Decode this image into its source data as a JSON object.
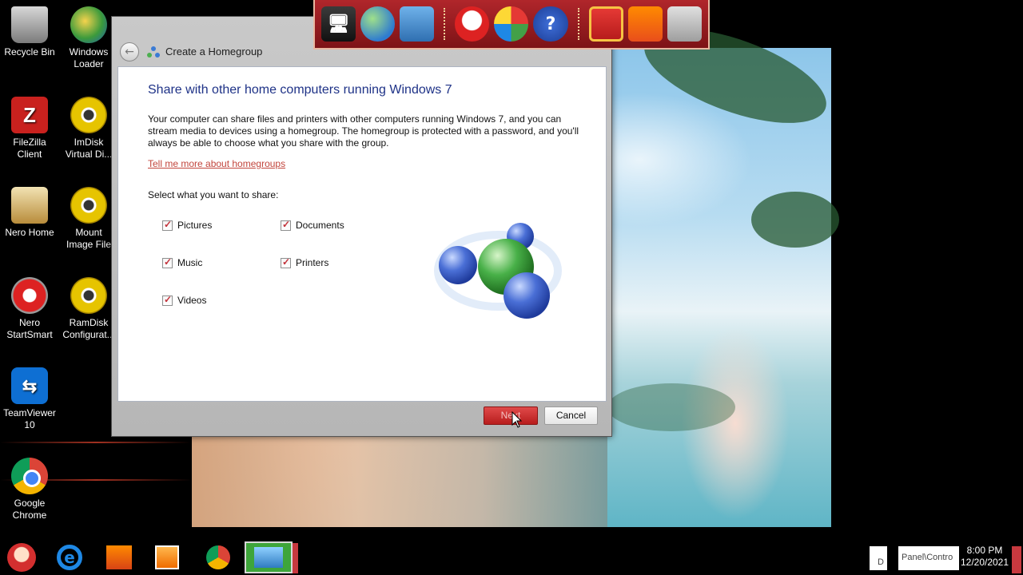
{
  "desktop": {
    "icons": [
      {
        "label": "Recycle Bin",
        "icon": "recycle-bin-icon"
      },
      {
        "label": "Windows\nLoader",
        "icon": "windows-loader-icon"
      },
      {
        "label": "FileZilla\nClient",
        "icon": "filezilla-icon"
      },
      {
        "label": "ImDisk\nVirtual Di...",
        "icon": "imdisk-icon"
      },
      {
        "label": "Nero Home",
        "icon": "nero-home-icon"
      },
      {
        "label": "Mount\nImage File",
        "icon": "mount-image-icon"
      },
      {
        "label": "Nero\nStartSmart",
        "icon": "nero-startsmart-icon"
      },
      {
        "label": "RamDisk\nConfigurat...",
        "icon": "ramdisk-icon"
      },
      {
        "label": "TeamViewer\n10",
        "icon": "teamviewer-icon"
      },
      {
        "label": "Google\nChrome",
        "icon": "chrome-icon"
      }
    ]
  },
  "dialog": {
    "title": "Create a Homegroup",
    "heading": "Share with other home computers running Windows 7",
    "description": "Your computer can share files and printers with other computers running Windows 7, and you can stream media to devices using a homegroup. The homegroup is protected with a password, and you'll always be able to choose what you share with the group.",
    "link": "Tell me more about homegroups",
    "select_label": "Select what you want to share:",
    "options": [
      {
        "label": "Pictures",
        "checked": true
      },
      {
        "label": "Documents",
        "checked": true
      },
      {
        "label": "Music",
        "checked": true
      },
      {
        "label": "Printers",
        "checked": true
      },
      {
        "label": "Videos",
        "checked": true
      }
    ],
    "next_label": "Next",
    "cancel_label": "Cancel"
  },
  "taskbar": {
    "items": [
      "santa-start-icon",
      "internet-explorer-icon",
      "file-manager-icon",
      "media-player-icon",
      "chrome-icon",
      "control-panel-icon"
    ],
    "tray_text_1": "D",
    "tray_text_2": "Panel\\Contro",
    "time": "8:00 PM",
    "date": "12/20/2021"
  },
  "colors": {
    "link": "#c2453c",
    "heading": "#1e3287",
    "accent_red": "#b81d1d",
    "dock": "#9c1d22"
  }
}
